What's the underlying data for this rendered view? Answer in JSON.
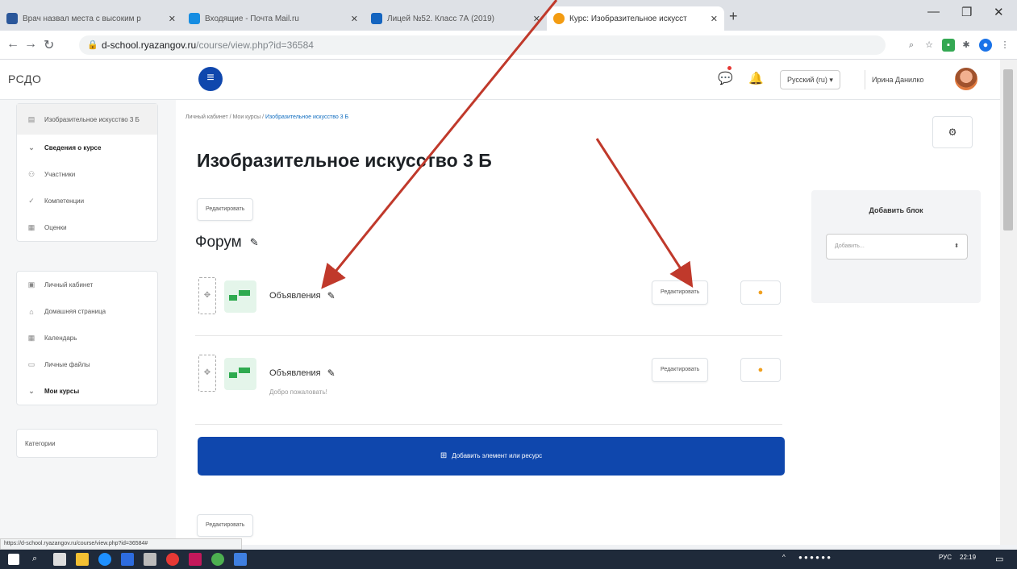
{
  "browser": {
    "tabs": [
      {
        "title": "Врач назвал места с высоким р",
        "fav_color": "#2b579a"
      },
      {
        "title": "Входящие - Почта Mail.ru",
        "fav_color": "#168de2"
      },
      {
        "title": "Лицей №52. Класс 7А (2019)",
        "fav_color": "#1565c0"
      },
      {
        "title": "Курс: Изобразительное искусст",
        "fav_color": "#f39c12"
      }
    ],
    "url_host": "d-school.ryazangov.ru",
    "url_path": "/course/view.php?id=36584",
    "status_url": "https://d-school.ryazangov.ru/course/view.php?id=36584#"
  },
  "header": {
    "brand": "РСДО",
    "language": "Русский (ru) ▾",
    "user_name": "Ирина Данилко"
  },
  "sidebar": {
    "course_items": [
      {
        "icon": "course-icon",
        "glyph": "▤",
        "label": "Изобразительное искусство 3 Б",
        "bold": false,
        "selected": true
      },
      {
        "icon": "chevron-down-icon",
        "glyph": "⌄",
        "label": "Сведения о курсе",
        "bold": true,
        "selected": false
      },
      {
        "icon": "users-icon",
        "glyph": "⚇",
        "label": "Участники",
        "bold": false,
        "selected": false
      },
      {
        "icon": "check-icon",
        "glyph": "✓",
        "label": "Компетенции",
        "bold": false,
        "selected": false
      },
      {
        "icon": "grades-icon",
        "glyph": "▦",
        "label": "Оценки",
        "bold": false,
        "selected": false
      }
    ],
    "nav_items": [
      {
        "icon": "dashboard-icon",
        "glyph": "▣",
        "label": "Личный кабинет",
        "bold": false
      },
      {
        "icon": "home-icon",
        "glyph": "⌂",
        "label": "Домашняя страница",
        "bold": false
      },
      {
        "icon": "calendar-icon",
        "glyph": "▦",
        "label": "Календарь",
        "bold": false
      },
      {
        "icon": "files-icon",
        "glyph": "▭",
        "label": "Личные файлы",
        "bold": false
      },
      {
        "icon": "chevron-down-icon",
        "glyph": "⌄",
        "label": "Мои курсы",
        "bold": true
      }
    ],
    "categories": "Категории"
  },
  "main": {
    "breadcrumb": {
      "item1": "Личный кабинет",
      "sep": " / ",
      "item2": "Мои курсы",
      "current": "Изобразительное искусство 3 Б"
    },
    "title": "Изобразительное искусство 3 Б",
    "edit_label": "Редактировать",
    "section_title": "Форум",
    "activities": [
      {
        "name": "Объявления",
        "description": ""
      },
      {
        "name": "Объявления",
        "description": "Добро пожаловать!"
      }
    ],
    "add_button": "Добавить элемент или ресурс"
  },
  "block": {
    "title": "Добавить блок",
    "select_placeholder": "Добавить..."
  },
  "taskbar": {
    "lang": "РУС",
    "time": "22:19"
  },
  "colors": {
    "primary": "#0f47ad",
    "arrow": "#c0392b",
    "forum_green": "#2eaa4f",
    "taskbar": "#1f2a3a"
  }
}
